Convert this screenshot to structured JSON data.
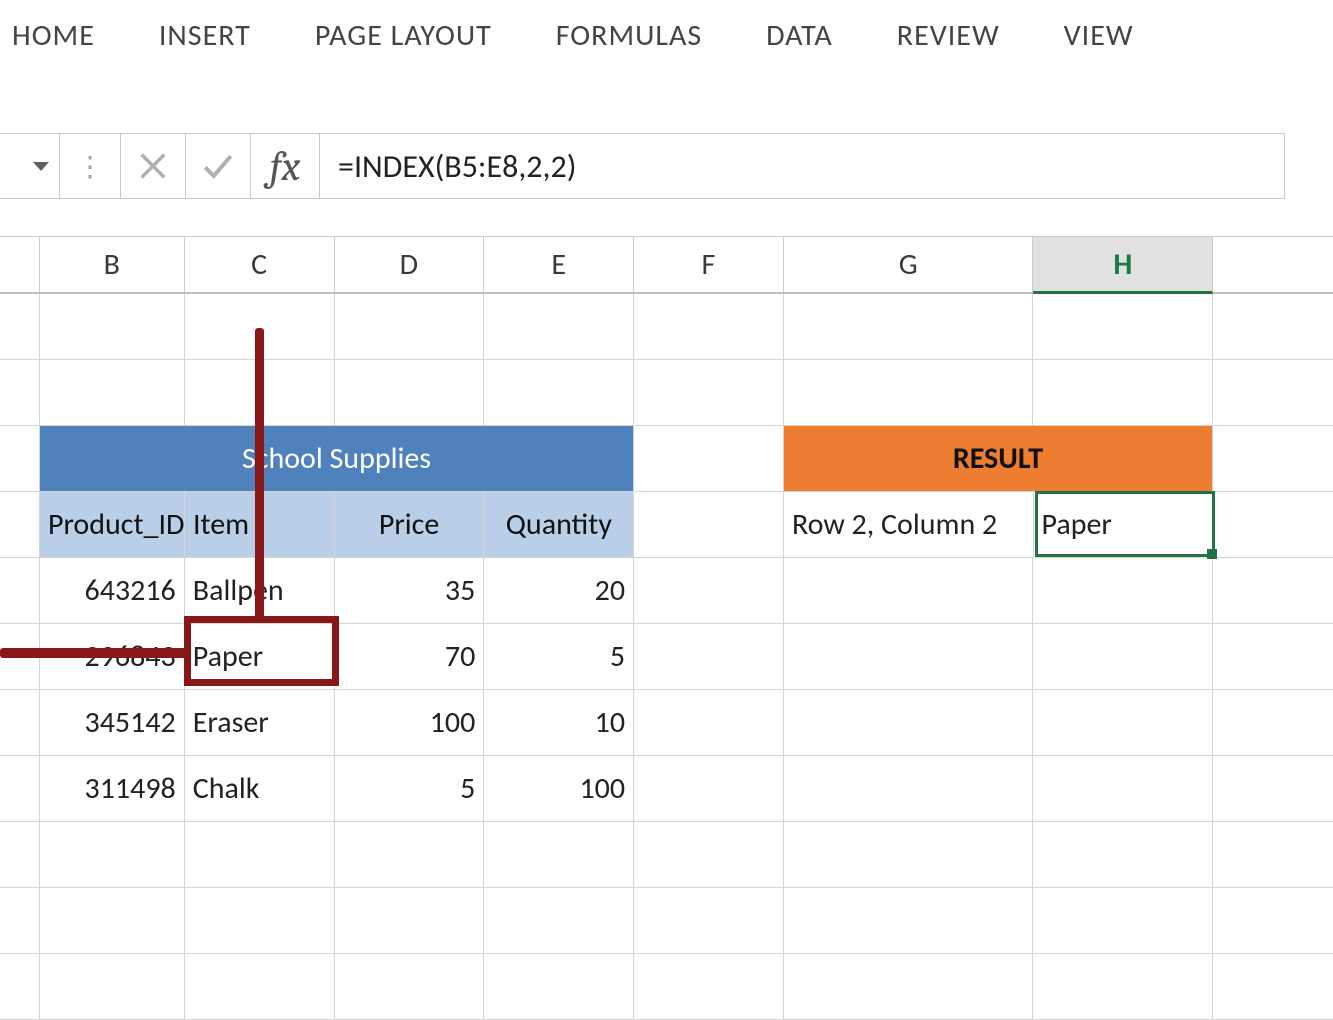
{
  "ribbon": {
    "tabs": [
      "HOME",
      "INSERT",
      "PAGE LAYOUT",
      "FORMULAS",
      "DATA",
      "REVIEW",
      "VIEW"
    ]
  },
  "formula_bar": {
    "namebox": "",
    "formula": "=INDEX(B5:E8,2,2)",
    "fx_label": "fx"
  },
  "columns": {
    "B": "B",
    "C": "C",
    "D": "D",
    "E": "E",
    "F": "F",
    "G": "G",
    "H": "H"
  },
  "sheet": {
    "table_title": "School Supplies",
    "headers": {
      "product_id": "Product_ID",
      "item": "Item",
      "price": "Price",
      "quantity": "Quantity"
    },
    "rows": [
      {
        "product_id": "643216",
        "item": "Ballpen",
        "price": "35",
        "quantity": "20"
      },
      {
        "product_id": "296843",
        "item": "Paper",
        "price": "70",
        "quantity": "5"
      },
      {
        "product_id": "345142",
        "item": "Eraser",
        "price": "100",
        "quantity": "10"
      },
      {
        "product_id": "311498",
        "item": "Chalk",
        "price": "5",
        "quantity": "100"
      }
    ],
    "result_title": "RESULT",
    "result_label": "Row 2, Column 2",
    "result_value": "Paper"
  },
  "active_cell": "H"
}
